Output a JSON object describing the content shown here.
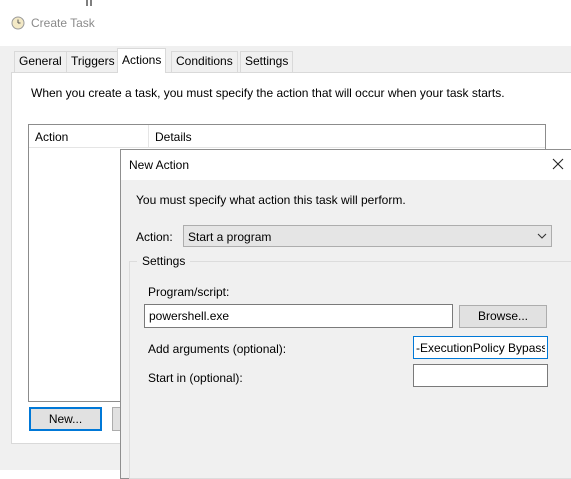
{
  "create_task": {
    "title": "Create Task",
    "tabs": [
      {
        "label": "General"
      },
      {
        "label": "Triggers"
      },
      {
        "label": "Actions"
      },
      {
        "label": "Conditions"
      },
      {
        "label": "Settings"
      }
    ],
    "active_tab": "Actions",
    "description": "When you create a task, you must specify the action that will occur when your task starts.",
    "table": {
      "columns": [
        "Action",
        "Details"
      ]
    },
    "new_button": "New..."
  },
  "new_action": {
    "title": "New Action",
    "instruction": "You must specify what action this task will perform.",
    "action_label": "Action:",
    "action_value": "Start a program",
    "settings_label": "Settings",
    "program_label": "Program/script:",
    "program_value": "powershell.exe",
    "browse_button": "Browse...",
    "args_label": "Add arguments (optional):",
    "args_value": "-ExecutionPolicy Bypass",
    "startin_label": "Start in (optional):",
    "startin_value": ""
  },
  "colors": {
    "accent": "#0078d7",
    "window_bg": "#f0f0f0",
    "title_disabled": "#8a8a8a"
  },
  "icons": {
    "app_icon": "clock-icon",
    "close_icon": "close-icon",
    "dropdown_icon": "chevron-down-icon"
  }
}
